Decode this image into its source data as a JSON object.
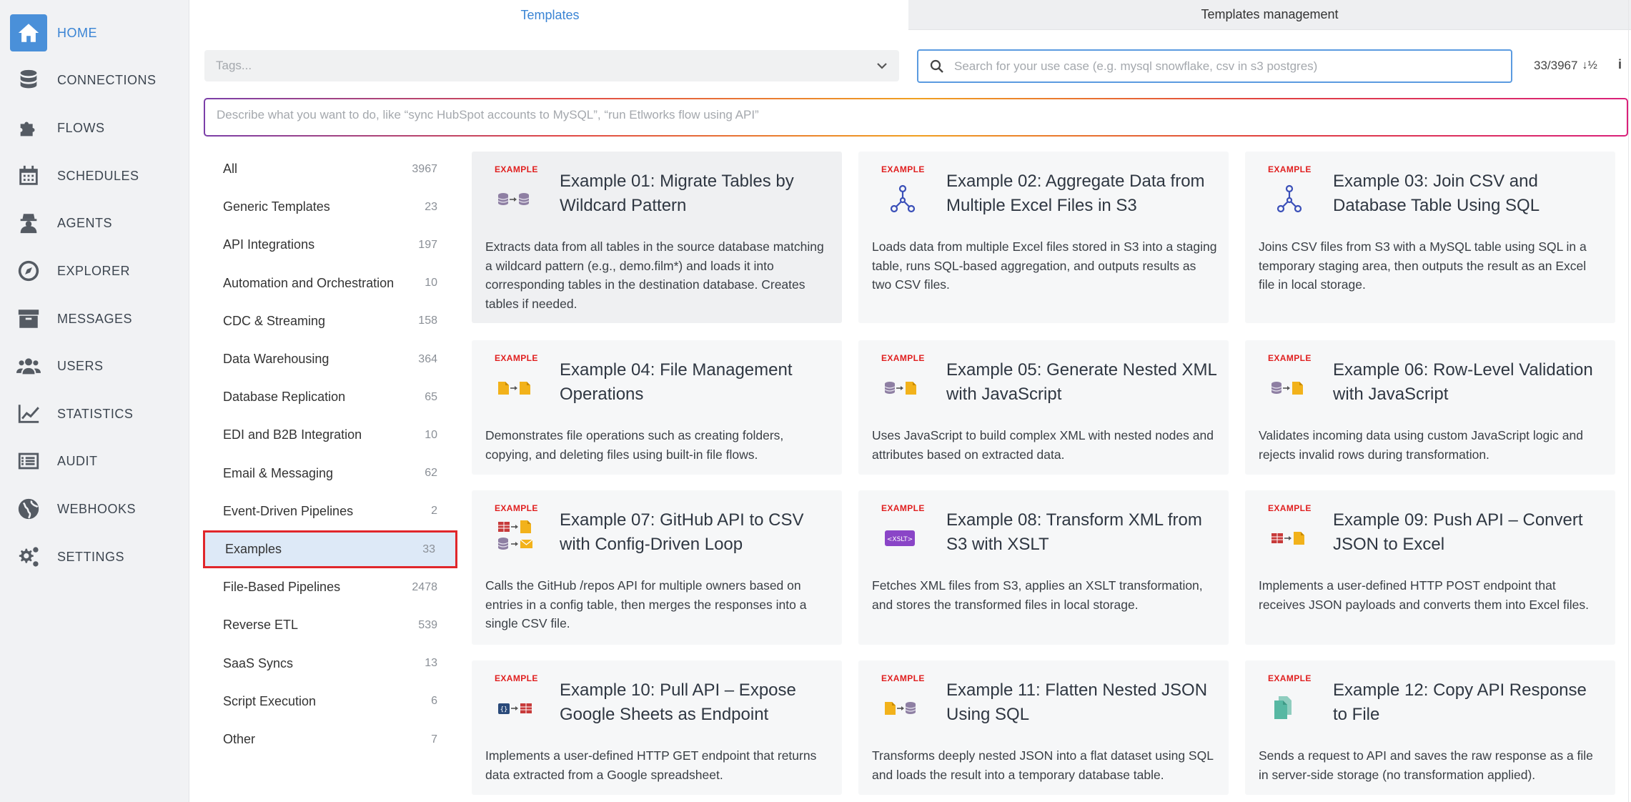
{
  "nav": [
    {
      "label": "HOME",
      "icon": "home-icon",
      "active": true
    },
    {
      "label": "CONNECTIONS",
      "icon": "database-icon"
    },
    {
      "label": "FLOWS",
      "icon": "puzzle-icon"
    },
    {
      "label": "SCHEDULES",
      "icon": "calendar-icon"
    },
    {
      "label": "AGENTS",
      "icon": "agent-icon"
    },
    {
      "label": "EXPLORER",
      "icon": "compass-icon"
    },
    {
      "label": "MESSAGES",
      "icon": "archive-icon"
    },
    {
      "label": "USERS",
      "icon": "users-icon"
    },
    {
      "label": "STATISTICS",
      "icon": "line-chart-icon"
    },
    {
      "label": "AUDIT",
      "icon": "list-icon"
    },
    {
      "label": "WEBHOOKS",
      "icon": "globe-icon"
    },
    {
      "label": "SETTINGS",
      "icon": "gears-icon"
    }
  ],
  "tabs": {
    "templates": "Templates",
    "management": "Templates management"
  },
  "tags_placeholder": "Tags...",
  "search_placeholder": "Search for your use case (e.g. mysql snowflake, csv in s3 postgres)",
  "result_count": "33/3967",
  "describe_placeholder": "Describe what you want to do, like “sync HubSpot accounts to MySQL”, “run Etlworks flow using API”",
  "categories": [
    {
      "name": "All",
      "count": "3967"
    },
    {
      "name": "Generic Templates",
      "count": "23"
    },
    {
      "name": "API Integrations",
      "count": "197"
    },
    {
      "name": "Automation and Orchestration",
      "count": "10"
    },
    {
      "name": "CDC & Streaming",
      "count": "158"
    },
    {
      "name": "Data Warehousing",
      "count": "364"
    },
    {
      "name": "Database Replication",
      "count": "65"
    },
    {
      "name": "EDI and B2B Integration",
      "count": "10"
    },
    {
      "name": "Email & Messaging",
      "count": "62"
    },
    {
      "name": "Event-Driven Pipelines",
      "count": "2"
    },
    {
      "name": "Examples",
      "count": "33",
      "selected": true
    },
    {
      "name": "File-Based Pipelines",
      "count": "2478"
    },
    {
      "name": "Reverse ETL",
      "count": "539"
    },
    {
      "name": "SaaS Syncs",
      "count": "13"
    },
    {
      "name": "Script Execution",
      "count": "6"
    },
    {
      "name": "Other",
      "count": "7"
    }
  ],
  "badge": "EXAMPLE",
  "cards": [
    {
      "title": "Example 01: Migrate Tables by Wildcard Pattern",
      "desc": "Extracts data from all tables in the source database matching a wildcard pattern (e.g., demo.film*) and loads it into corresponding tables in the destination database. Creates tables if needed.",
      "icon": "db-to-db-icon"
    },
    {
      "title": "Example 02: Aggregate Data from Multiple Excel Files in S3",
      "desc": "Loads data from multiple Excel files stored in S3 into a staging table, runs SQL-based aggregation, and outputs results as two CSV files.",
      "icon": "flow-graph-icon"
    },
    {
      "title": "Example 03: Join CSV and Database Table Using SQL",
      "desc": "Joins CSV files from S3 with a MySQL table using SQL in a temporary staging area, then outputs the result as an Excel file in local storage.",
      "icon": "flow-graph-icon"
    },
    {
      "title": "Example 04: File Management Operations",
      "desc": "Demonstrates file operations such as creating folders, copying, and deleting files using built-in file flows.",
      "icon": "file-to-file-icon"
    },
    {
      "title": "Example 05: Generate Nested XML with JavaScript",
      "desc": "Uses JavaScript to build complex XML with nested nodes and attributes based on extracted data.",
      "icon": "db-to-file-icon"
    },
    {
      "title": "Example 06: Row-Level Validation with JavaScript",
      "desc": "Validates incoming data using custom JavaScript logic and rejects invalid rows during transformation.",
      "icon": "db-to-file-icon"
    },
    {
      "title": "Example 07: GitHub API to CSV with Config-Driven Loop",
      "desc": "Calls the GitHub /repos API for multiple owners based on entries in a config table, then merges the responses into a single CSV file.",
      "icon": "api-loop-icon"
    },
    {
      "title": "Example 08: Transform XML from S3 with XSLT",
      "desc": "Fetches XML files from S3, applies an XSLT transformation, and stores the transformed files in local storage.",
      "icon": "xslt-icon"
    },
    {
      "title": "Example 09: Push API – Convert JSON to Excel",
      "desc": "Implements a user-defined HTTP POST endpoint that receives JSON payloads and converts them into Excel files.",
      "icon": "api-to-file-icon"
    },
    {
      "title": "Example 10: Pull API – Expose Google Sheets as Endpoint",
      "desc": "Implements a user-defined HTTP GET endpoint that returns data extracted from a Google spreadsheet.",
      "icon": "json-to-api-icon"
    },
    {
      "title": "Example 11: Flatten Nested JSON Using SQL",
      "desc": "Transforms deeply nested JSON into a flat dataset using SQL and loads the result into a temporary database table.",
      "icon": "file-to-db-icon"
    },
    {
      "title": "Example 12: Copy API Response to File",
      "desc": "Sends a request to API and saves the raw response as a file in server-side storage (no transformation applied).",
      "icon": "file-copy-icon"
    }
  ]
}
